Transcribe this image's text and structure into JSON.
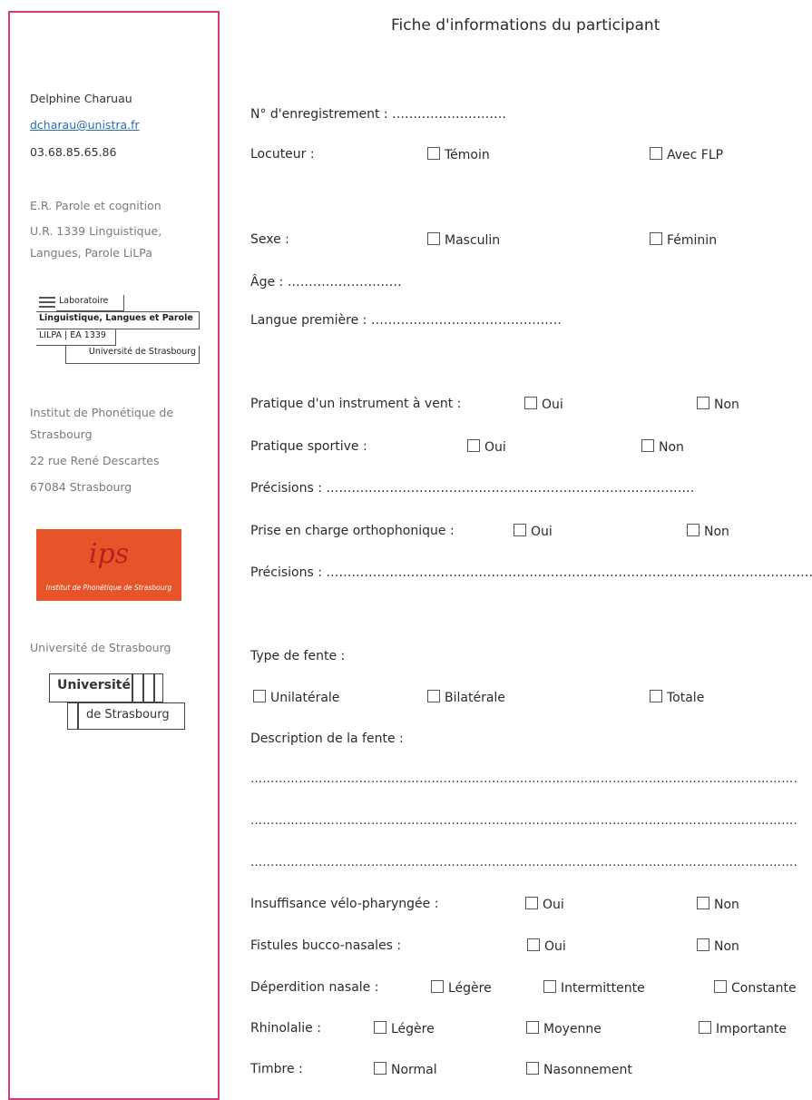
{
  "sidebar": {
    "contact_name": "Delphine Charuau",
    "contact_email": "dcharau@unistra.fr",
    "contact_phone": "03.68.85.65.86",
    "team_line1": "E.R. Parole et cognition",
    "team_line2": "U.R. 1339 Linguistique,",
    "team_line3": "Langues, Parole LiLPa",
    "lab_logo": {
      "line1": "Laboratoire",
      "line2": "Linguistique, Langues et Parole",
      "line3": "LILPA | EA 1339",
      "line4": "Université de Strasbourg"
    },
    "institute_line1": "Institut de Phonétique de",
    "institute_line2": "Strasbourg",
    "institute_line3": "22 rue René Descartes",
    "institute_line4": "67084 Strasbourg",
    "ips_logo": {
      "big": "ips",
      "small": "Institut de Phonétique de Strasbourg"
    },
    "university_text": "Université de Strasbourg",
    "unistra_logo": {
      "top": "Université",
      "bottom": "de Strasbourg"
    }
  },
  "form": {
    "title": "Fiche d'informations du participant",
    "registration": "N° d'enregistrement : ………………………",
    "speaker": {
      "label": "Locuteur :",
      "opt1": "Témoin",
      "opt2": "Avec FLP"
    },
    "sex": {
      "label": "Sexe :",
      "opt1": "Masculin",
      "opt2": "Féminin"
    },
    "age": "Âge : ………………………",
    "first_language": "Langue première : ………………………………………",
    "wind_instrument": {
      "label": "Pratique d'un instrument à vent :",
      "yes": "Oui",
      "no": "Non"
    },
    "sport": {
      "label": "Pratique sportive :",
      "yes": "Oui",
      "no": "Non"
    },
    "precisions1": "Précisions : ………………………………………………………………………………………………",
    "speech_therapy": {
      "label": "Prise en charge orthophonique :",
      "yes": "Oui",
      "no": "Non"
    },
    "precisions2": "Précisions : ……………………………………………………………………………………………………………………………",
    "cleft_type": {
      "label": "Type de fente :",
      "opt1": "Unilatérale",
      "opt2": "Bilatérale",
      "opt3": "Totale"
    },
    "cleft_description_label": "Description de la fente :",
    "dotted_line": "……………………………………………………………………………………………………………………………………………………………",
    "vpi": {
      "label": "Insuffisance vélo-pharyngée :",
      "yes": "Oui",
      "no": "Non"
    },
    "fistula": {
      "label": "Fistules bucco-nasales :",
      "yes": "Oui",
      "no": "Non"
    },
    "nasal_loss": {
      "label": "Déperdition nasale :",
      "opt1": "Légère",
      "opt2": "Intermittente",
      "opt3": "Constante"
    },
    "rhinolalia": {
      "label": "Rhinolalie :",
      "opt1": "Légère",
      "opt2": "Moyenne",
      "opt3": "Importante"
    },
    "timbre": {
      "label": "Timbre :",
      "opt1": "Normal",
      "opt2": "Nasonnement"
    }
  }
}
